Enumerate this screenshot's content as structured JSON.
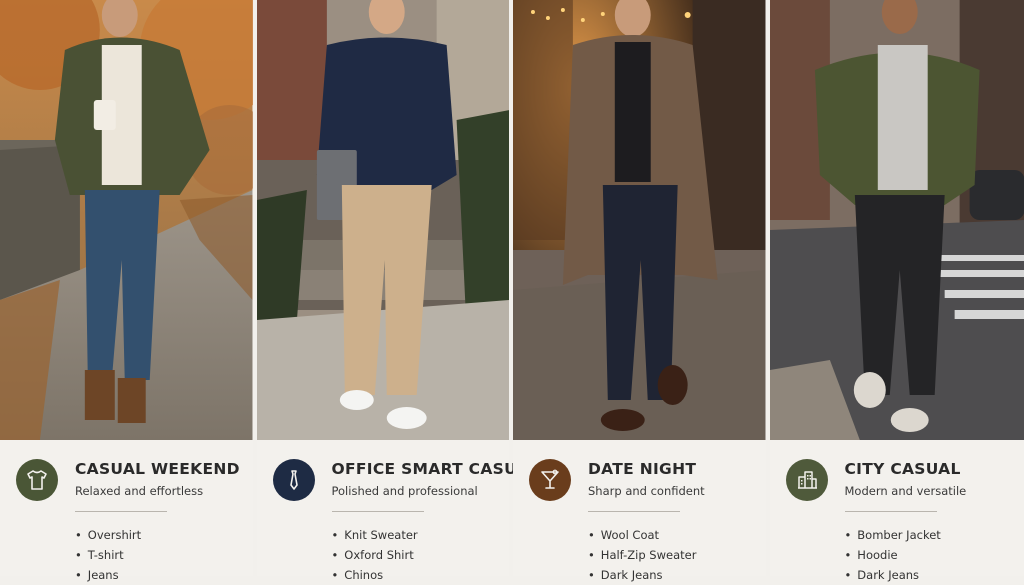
{
  "columns": [
    {
      "id": "casual-weekend",
      "title": "CASUAL WEEKEND",
      "subtitle": "Relaxed and effortless",
      "icon": "tshirt-icon",
      "icon_color": "#4a5636",
      "items": [
        "Overshirt",
        "T-shirt",
        "Jeans"
      ]
    },
    {
      "id": "office-smart-casual",
      "title": "OFFICE SMART CASUAL",
      "subtitle": "Polished and professional",
      "icon": "tie-icon",
      "icon_color": "#1e2b44",
      "items": [
        "Knit Sweater",
        "Oxford Shirt",
        "Chinos"
      ]
    },
    {
      "id": "date-night",
      "title": "DATE NIGHT",
      "subtitle": "Sharp and confident",
      "icon": "cocktail-glass-icon",
      "icon_color": "#6a3d1c",
      "items": [
        "Wool Coat",
        "Half-Zip Sweater",
        "Dark Jeans"
      ]
    },
    {
      "id": "city-casual",
      "title": "CITY CASUAL",
      "subtitle": "Modern and versatile",
      "icon": "city-buildings-icon",
      "icon_color": "#4f5a3b",
      "items": [
        "Bomber Jacket",
        "Hoodie",
        "Dark Jeans"
      ]
    }
  ]
}
